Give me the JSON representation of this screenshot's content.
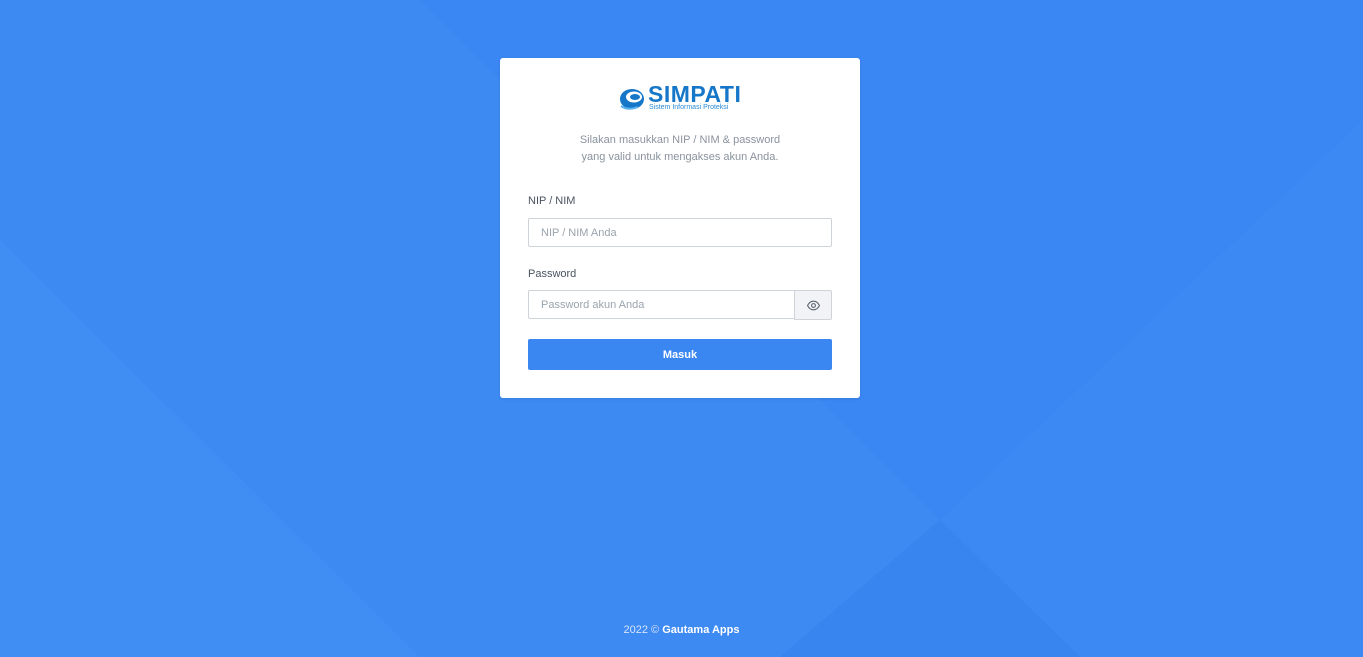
{
  "logo": {
    "name": "SIMPATI",
    "tagline": "Sistem Informasi Proteksi"
  },
  "intro": {
    "line1": "Silakan masukkan NIP / NIM & password",
    "line2": "yang valid untuk mengakses akun Anda."
  },
  "form": {
    "nip_label": "NIP / NIM",
    "nip_placeholder": "NIP / NIM Anda",
    "password_label": "Password",
    "password_placeholder": "Password akun Anda",
    "toggle_icon": "eye-icon",
    "submit_label": "Masuk"
  },
  "footer": {
    "year": "2022 ©",
    "brand": "Gautama Apps"
  },
  "colors": {
    "background": "#3b87f2",
    "primary": "#3b87f2",
    "card": "#ffffff",
    "logo": "#1677c8"
  }
}
